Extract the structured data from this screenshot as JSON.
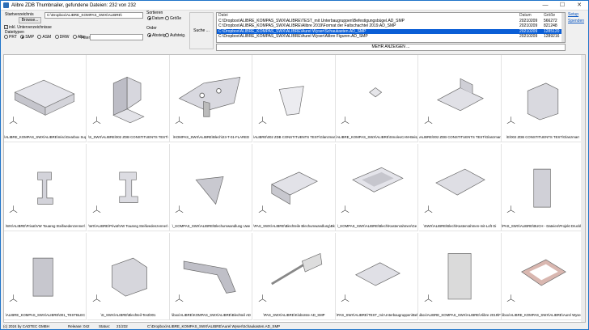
{
  "window": {
    "title": "Alibre ZDB Thumbnailer, gefundene Dateien: 232 von 232",
    "min": "—",
    "max": "☐",
    "close": "✕"
  },
  "filters": {
    "start_label": "Startverzeichnis",
    "browse_label": "Browse...",
    "path": "C:\\Dropbox\\ALIBRE_KOMPAS_SWX\\ALIBRE\\",
    "subdirs_label": "inkl. Unterverzeichnisse",
    "filetypes_label": "Dateitypen",
    "types": [
      "PRT",
      "SMP",
      "ASM",
      "DRW",
      "Alle"
    ],
    "filter_label": "Filter",
    "sort_label": "Sortieren",
    "sort_options": [
      "Datum",
      "Größe"
    ],
    "order_label": "Order",
    "order_options": [
      "Absteig.",
      "Aufsteig."
    ],
    "search_label": "Suche ..."
  },
  "filelist": {
    "col_file": "Datei",
    "col_date": "Datum",
    "col_size": "Größe",
    "rows": [
      {
        "path": "C:\\Dropbox\\ALIBRE_KOMPAS_SWX\\ALIBRE\\TEST_mit Unterbaugruppen\\Befestigungsbügel.AD_SMP",
        "date": "20210209",
        "size": "566272"
      },
      {
        "path": "C:\\Dropbox\\ALIBRE_KOMPAS_SWX\\ALIBRE\\Alibre 2019\\Format der Faltschachtel 2019.AD_SMP",
        "date": "20210209",
        "size": "821248"
      },
      {
        "path": "C:\\Dropbox\\ALIBRE_KOMPAS_SWX\\ALIBRE\\Aurel Wyser\\Schaukasten.AD_SMP",
        "date": "20210209",
        "size": "1285120"
      },
      {
        "path": "C:\\Dropbox\\ALIBRE_KOMPAS_SWX\\ALIBRE\\Aurel Wyser\\Alibre Figuren.AD_SMP",
        "date": "20210209",
        "size": "1289216"
      }
    ],
    "more_button": "MEHR ANZEIGEN ..."
  },
  "side_links": {
    "setup": "Setup",
    "spenden": "Spenden"
  },
  "captions": [
    [
      "\\ALIBRE_KOMPAS_SWX\\ALIBRE\\misc\\Gearbox Supp",
      "\\S_SWX\\ALIBRE\\002 ZDB CONSTITUENTS TEST\\",
      "\\KOMPAS_SWX\\ALIBRE\\Blech\\23-T-01-FLARED",
      "\\ALIBRE\\002 ZDB CONSTITUENTS TEST\\Glanzmar",
      "\\ALIBRE_KOMPAS_SWX\\ALIBRE\\SmolexCAM-Beispiele\\V5 Blechab",
      "\\ALIBRE\\002 ZDB CONSTITUENTS TEST\\Glanzmarr",
      "\\E\\002 ZDB CONSTITUENTS TEST\\Glanzmarr"
    ],
    [
      "\\WX\\ALIBRE\\Privat\\VW Touareg Steifwedenzenner\\",
      "\\WX\\ALIBRE\\Privat\\VW Touareg Steifwedenzenner\\",
      "\\_KOMPAS_SWX\\ALIBRE\\Blechumwandlung Uwe",
      "\\PAS_SWX\\ALIBRE\\Blechteile Blechumwandlung\\Bk",
      "\\_KOMPAS_SWX\\ALIBRE\\Blech\\Kastenrahmen\\Ge",
      "\\SWX\\ALIBRE\\Blech\\Kastenrahmen-mit-Loft Gi",
      "\\PAS_SWX\\ALIBRE\\BUCH - Dateien\\Projekt Druckluftne"
    ],
    [
      "\\ALIBRE_KOMPAS_SWX\\ALIBRE\\001_TESTBLEC",
      "\\S_SWX\\ALIBRE\\Blechteil-Test\\001",
      "\\ibox\\ALIBRE\\KOMPAS_SWX\\ALIBRE\\Blechteil AD",
      "\\PAS_SWX\\ALIBRE\\Klobürste AD_SMP",
      "\\PAS_SWX\\ALIBRE\\TEST_mit Unterbaugruppen\\Bef",
      "\\ibox\\ALIBRE_KOMPAS_SWX\\ALIBRE\\Alibre 2019\\Format der Faltsc",
      "\\ibox\\ALIBRE_KOMPAS_SWX\\ALIBRE\\Aurel Wyser\\Schauk"
    ]
  ],
  "status": {
    "copyright": "(c) 2024 by CADTEC GMBH",
    "release_label": "Release: 042",
    "status_label": "Status:",
    "status_value": "21/232",
    "current": "C:\\Dropbox\\ALIBRE_KOMPAS_SWX\\ALIBRE\\Aurel Wyser\\Schaukasten.AD_SMP"
  }
}
